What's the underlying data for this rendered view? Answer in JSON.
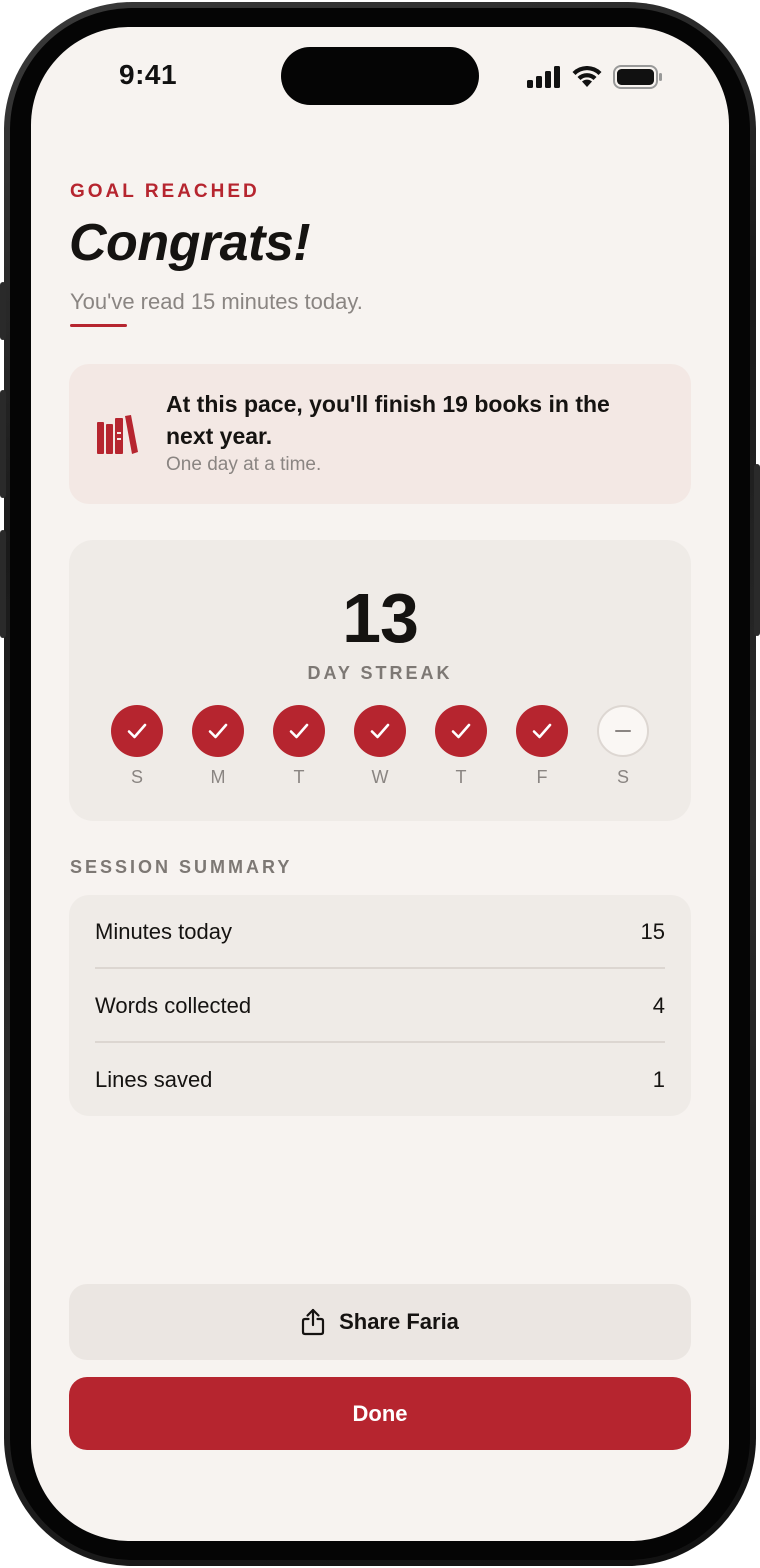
{
  "status_bar": {
    "time": "9:41"
  },
  "header": {
    "eyebrow": "GOAL REACHED",
    "title": "Congrats!",
    "subtitle": "You've read 15 minutes today."
  },
  "projection": {
    "icon": "books-icon",
    "text": "At this pace, you'll finish 19 books in the next year.",
    "subtext": "One day at a time."
  },
  "streak": {
    "count": "13",
    "label": "DAY STREAK",
    "days": [
      {
        "letter": "S",
        "status": "done"
      },
      {
        "letter": "M",
        "status": "done"
      },
      {
        "letter": "T",
        "status": "done"
      },
      {
        "letter": "W",
        "status": "done"
      },
      {
        "letter": "T",
        "status": "done"
      },
      {
        "letter": "F",
        "status": "done"
      },
      {
        "letter": "S",
        "status": "pending"
      }
    ]
  },
  "session_summary": {
    "title": "SESSION SUMMARY",
    "rows": [
      {
        "label": "Minutes today",
        "value": "15"
      },
      {
        "label": "Words collected",
        "value": "4"
      },
      {
        "label": "Lines saved",
        "value": "1"
      }
    ]
  },
  "actions": {
    "share_label": "Share Faria",
    "done_label": "Done"
  },
  "colors": {
    "accent": "#b6252f",
    "background": "#f7f3f0",
    "card": "#efebe7",
    "projection_card": "#f3e8e4"
  }
}
